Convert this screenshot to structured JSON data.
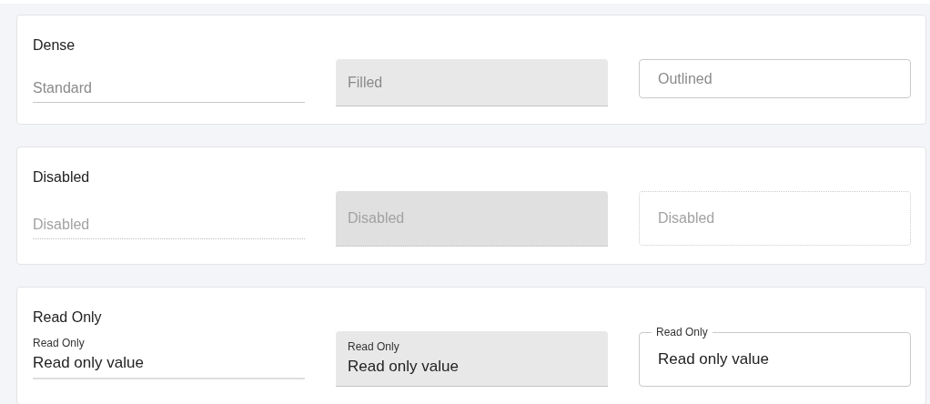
{
  "sections": [
    {
      "title": "Dense",
      "dense": true,
      "fields": [
        {
          "kind": "standard",
          "label": "Standard",
          "disabled": false
        },
        {
          "kind": "filled",
          "label": "Filled",
          "disabled": false
        },
        {
          "kind": "outlined",
          "label": "Outlined",
          "disabled": false
        }
      ]
    },
    {
      "title": "Disabled",
      "dense": false,
      "fields": [
        {
          "kind": "standard",
          "label": "Disabled",
          "disabled": true
        },
        {
          "kind": "filled",
          "label": "Disabled",
          "disabled": true
        },
        {
          "kind": "outlined",
          "label": "Disabled",
          "disabled": true
        }
      ]
    },
    {
      "title": "Read Only",
      "dense": false,
      "fields": [
        {
          "kind": "standard",
          "label": "Read Only",
          "value": "Read only value",
          "disabled": false
        },
        {
          "kind": "filled",
          "label": "Read Only",
          "value": "Read only value",
          "disabled": false
        },
        {
          "kind": "outlined",
          "label": "Read Only",
          "value": "Read only value",
          "disabled": false
        }
      ]
    }
  ]
}
